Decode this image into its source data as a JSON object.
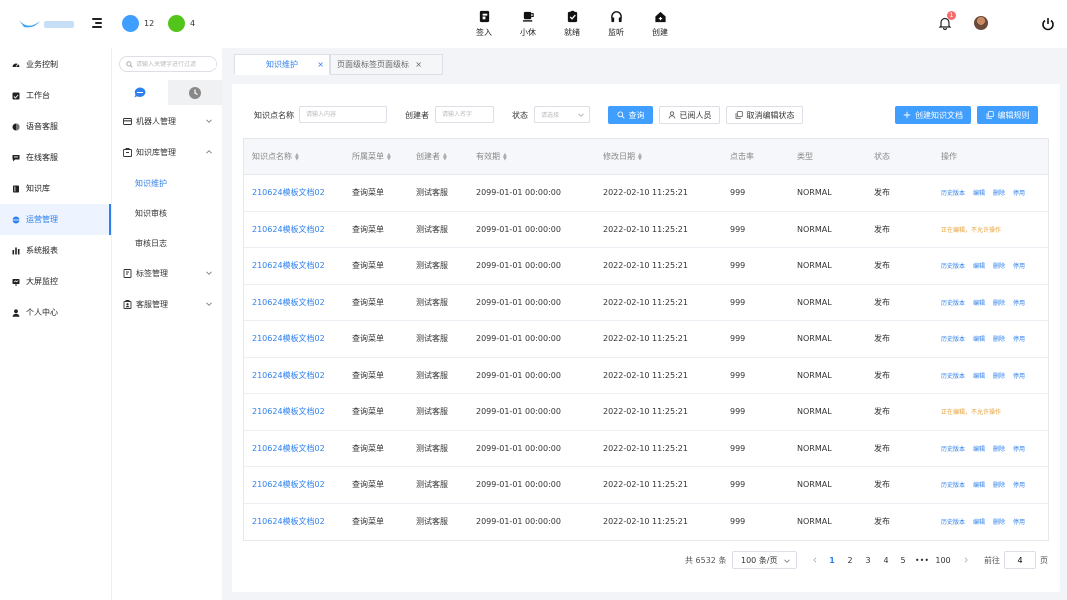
{
  "topbar": {
    "indicators": [
      {
        "color": "#409eff",
        "count": "12"
      },
      {
        "color": "#52c41a",
        "count": "4"
      }
    ],
    "actions": [
      {
        "label": "签入",
        "icon": "sign-in-icon"
      },
      {
        "label": "小休",
        "icon": "coffee-icon"
      },
      {
        "label": "就绪",
        "icon": "clipboard-check-icon"
      },
      {
        "label": "监听",
        "icon": "headphones-icon"
      },
      {
        "label": "创建",
        "icon": "house-plus-icon"
      }
    ],
    "notification_count": "1"
  },
  "leftnav": {
    "items": [
      {
        "label": "业务控制",
        "icon": "speedometer-icon"
      },
      {
        "label": "工作台",
        "icon": "workbench-icon"
      },
      {
        "label": "语音客服",
        "icon": "voice-icon"
      },
      {
        "label": "在线客服",
        "icon": "chat-icon"
      },
      {
        "label": "知识库",
        "icon": "book-icon"
      },
      {
        "label": "运营管理",
        "icon": "operations-icon",
        "active": true
      },
      {
        "label": "系统报表",
        "icon": "report-icon"
      },
      {
        "label": "大屏监控",
        "icon": "monitor-icon"
      },
      {
        "label": "个人中心",
        "icon": "person-icon"
      }
    ]
  },
  "subnav": {
    "search_placeholder": "请输入关键字进行过滤",
    "groups": [
      {
        "label": "机器人管理",
        "icon": "robot-card-icon",
        "expanded": false
      },
      {
        "label": "知识库管理",
        "icon": "knowledge-box-icon",
        "expanded": true
      },
      {
        "label": "标签管理",
        "icon": "tag-icon",
        "expanded": false
      },
      {
        "label": "客服管理",
        "icon": "agent-icon",
        "expanded": false
      }
    ],
    "children": [
      "知识维护",
      "知识审核",
      "审核日志"
    ]
  },
  "page_tabs": [
    {
      "label": "知识维护",
      "active": true
    },
    {
      "label": "页面级标签页面级标",
      "active": false
    }
  ],
  "filters": {
    "name_label": "知识点名称",
    "name_placeholder": "请输入内容",
    "creator_label": "创建者",
    "creator_placeholder": "请输入名字",
    "status_label": "状态",
    "status_placeholder": "请选择",
    "search_button": "查询",
    "viewed_button": "已阅人员",
    "cancel_edit_button": "取消编辑状态",
    "create_button": "创建知识文档",
    "edit_rules_button": "编辑规则"
  },
  "table": {
    "headers": [
      "知识点名称",
      "所属菜单",
      "创建者",
      "有效期",
      "修改日期",
      "点击率",
      "类型",
      "状态",
      "操作"
    ],
    "rows": [
      {
        "name": "210624模板文档02",
        "menu": "查询菜单",
        "creator": "测试客服",
        "expire": "2099-01-01 00:00:00",
        "modified": "2022-02-10 11:25:21",
        "clicks": "999",
        "type": "NORMAL",
        "status": "发布",
        "editing": false
      },
      {
        "name": "210624模板文档02",
        "menu": "查询菜单",
        "creator": "测试客服",
        "expire": "2099-01-01 00:00:00",
        "modified": "2022-02-10 11:25:21",
        "clicks": "999",
        "type": "NORMAL",
        "status": "发布",
        "editing": true
      },
      {
        "name": "210624模板文档02",
        "menu": "查询菜单",
        "creator": "测试客服",
        "expire": "2099-01-01 00:00:00",
        "modified": "2022-02-10 11:25:21",
        "clicks": "999",
        "type": "NORMAL",
        "status": "发布",
        "editing": false
      },
      {
        "name": "210624模板文档02",
        "menu": "查询菜单",
        "creator": "测试客服",
        "expire": "2099-01-01 00:00:00",
        "modified": "2022-02-10 11:25:21",
        "clicks": "999",
        "type": "NORMAL",
        "status": "发布",
        "editing": false
      },
      {
        "name": "210624模板文档02",
        "menu": "查询菜单",
        "creator": "测试客服",
        "expire": "2099-01-01 00:00:00",
        "modified": "2022-02-10 11:25:21",
        "clicks": "999",
        "type": "NORMAL",
        "status": "发布",
        "editing": false
      },
      {
        "name": "210624模板文档02",
        "menu": "查询菜单",
        "creator": "测试客服",
        "expire": "2099-01-01 00:00:00",
        "modified": "2022-02-10 11:25:21",
        "clicks": "999",
        "type": "NORMAL",
        "status": "发布",
        "editing": false
      },
      {
        "name": "210624模板文档02",
        "menu": "查询菜单",
        "creator": "测试客服",
        "expire": "2099-01-01 00:00:00",
        "modified": "2022-02-10 11:25:21",
        "clicks": "999",
        "type": "NORMAL",
        "status": "发布",
        "editing": true
      },
      {
        "name": "210624模板文档02",
        "menu": "查询菜单",
        "creator": "测试客服",
        "expire": "2099-01-01 00:00:00",
        "modified": "2022-02-10 11:25:21",
        "clicks": "999",
        "type": "NORMAL",
        "status": "发布",
        "editing": false
      },
      {
        "name": "210624模板文档02",
        "menu": "查询菜单",
        "creator": "测试客服",
        "expire": "2099-01-01 00:00:00",
        "modified": "2022-02-10 11:25:21",
        "clicks": "999",
        "type": "NORMAL",
        "status": "发布",
        "editing": false
      },
      {
        "name": "210624模板文档02",
        "menu": "查询菜单",
        "creator": "测试客服",
        "expire": "2099-01-01 00:00:00",
        "modified": "2022-02-10 11:25:21",
        "clicks": "999",
        "type": "NORMAL",
        "status": "发布",
        "editing": false
      }
    ],
    "ops": [
      "历史版本",
      "编辑",
      "删除",
      "停用"
    ],
    "editing_text": "正在编辑，不允许操作"
  },
  "pagination": {
    "total": "共 6532 条",
    "page_size": "100 条/页",
    "pages": [
      "1",
      "2",
      "3",
      "4",
      "5",
      "•••",
      "100"
    ],
    "current": "1",
    "goto_label": "前往",
    "goto_value": "4",
    "page_suffix": "页"
  },
  "colors": {
    "accent": "#409eff",
    "link": "#2f80ed",
    "warning": "#e6a23c"
  }
}
